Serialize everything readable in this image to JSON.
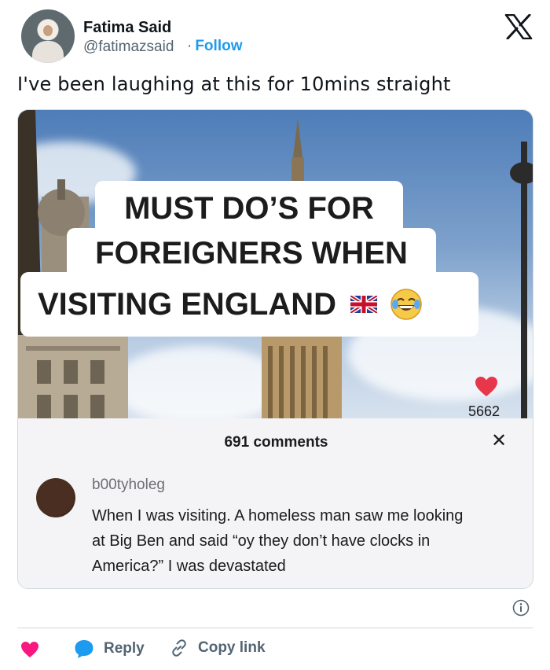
{
  "author": {
    "name": "Fatima Said",
    "handle": "@fatimazsaid",
    "follow_separator": "·",
    "follow_label": "Follow"
  },
  "platform_icon": "x-logo-icon",
  "tweet": {
    "text": "I've been laughing at this for 10mins straight"
  },
  "media": {
    "caption_lines": [
      "MUST DO’S FOR",
      "FOREIGNERS WHEN",
      "VISITING  ENGLAND"
    ],
    "caption_emojis": [
      "uk-flag-icon",
      "laughing-face-icon"
    ],
    "comments_count": "691 comments",
    "close_icon": "close-icon",
    "comment": {
      "username": "b00tyholeg",
      "text": "When I was visiting. A homeless man saw me looking at Big Ben and said “oy they don’t have clocks in America?” I was devastated",
      "likes": "5662",
      "heart_color": "#e8364a"
    }
  },
  "actions": {
    "like_icon": "heart-icon",
    "reply_label": "Reply",
    "copy_label": "Copy link"
  },
  "colors": {
    "accent": "#1d9bf0",
    "like": "#f91880",
    "muted": "#536471"
  }
}
